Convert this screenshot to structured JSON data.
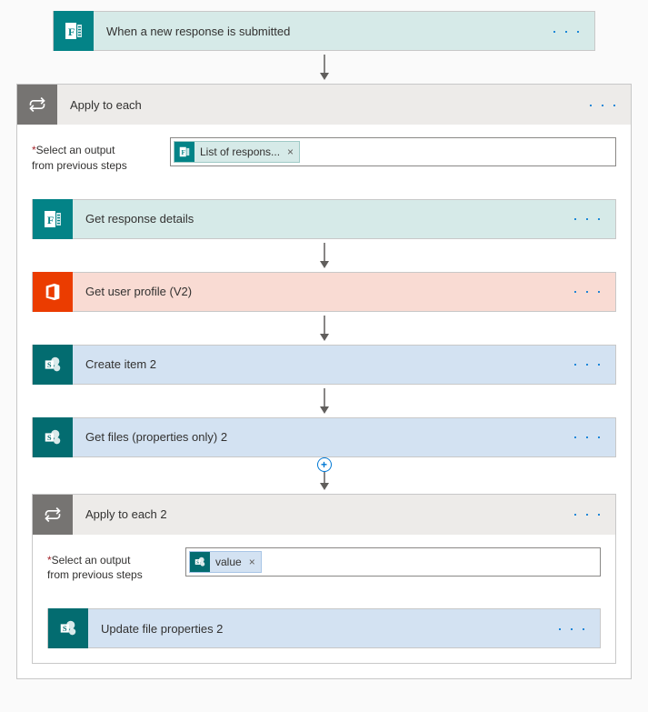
{
  "trigger": {
    "title": "When a new response is submitted",
    "menu": "· · ·"
  },
  "loop1": {
    "title": "Apply to each",
    "menu": "· · ·",
    "output_label_star": "*",
    "output_label_line1": "Select an output",
    "output_label_line2": "from previous steps",
    "token_label": "List of respons...",
    "token_x": "×",
    "actions": [
      {
        "title": "Get response details",
        "menu": "· · ·"
      },
      {
        "title": "Get user profile (V2)",
        "menu": "· · ·"
      },
      {
        "title": "Create item 2",
        "menu": "· · ·"
      },
      {
        "title": "Get files (properties only) 2",
        "menu": "· · ·"
      }
    ],
    "plus": "+"
  },
  "loop2": {
    "title": "Apply to each 2",
    "menu": "· · ·",
    "output_label_star": "*",
    "output_label_line1": "Select an output",
    "output_label_line2": "from previous steps",
    "token_label": "value",
    "token_x": "×",
    "action": {
      "title": "Update file properties 2",
      "menu": "· · ·"
    }
  }
}
